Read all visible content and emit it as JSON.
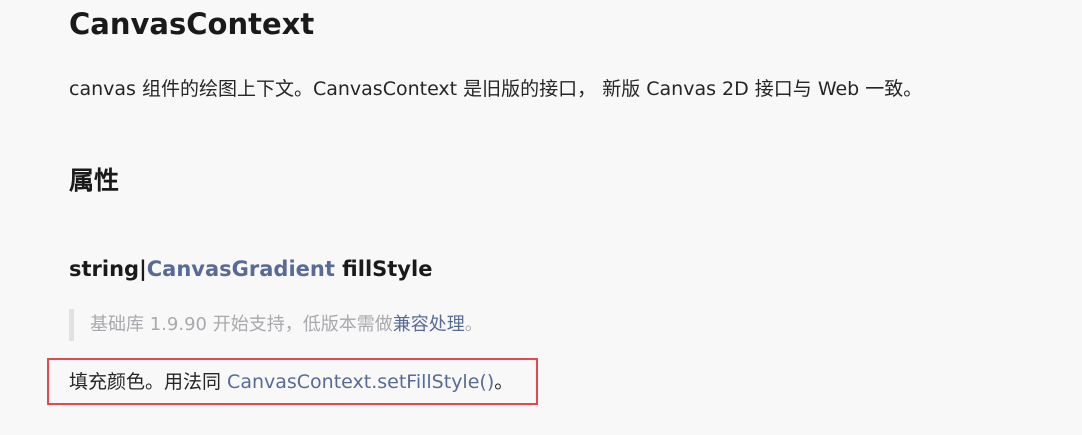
{
  "doc": {
    "title": "CanvasContext",
    "intro": "canvas 组件的绘图上下文。CanvasContext 是旧版的接口， 新版 Canvas 2D 接口与 Web 一致。",
    "section_heading": "属性",
    "property": {
      "type_prefix": "string|",
      "type_link": "CanvasGradient",
      "name": " fillStyle"
    },
    "notice": {
      "text": "基础库 1.9.90 开始支持，低版本需做",
      "link": "兼容处理",
      "suffix": "。"
    },
    "description": {
      "text": "填充颜色。用法同 ",
      "link": "CanvasContext.setFillStyle()",
      "suffix": "。"
    }
  },
  "colors": {
    "link": "#576b95",
    "highlight_border": "#e5484d",
    "notice_text": "#a9a9ad",
    "background": "#f8f8f9"
  }
}
